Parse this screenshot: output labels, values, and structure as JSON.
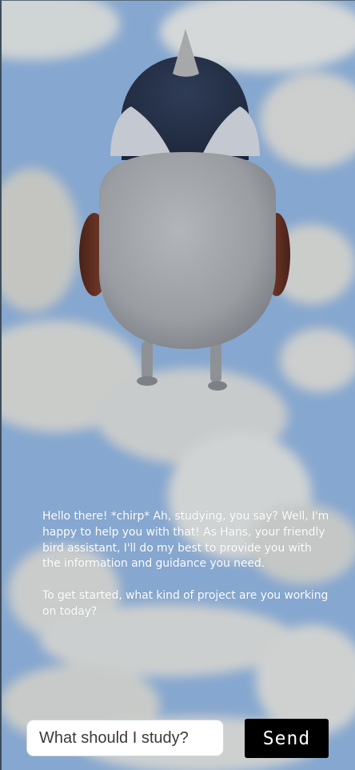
{
  "chat": {
    "assistant_message": "Hello there! *chirp* Ah, studying, you say? Well, I'm happy to help you with that! As Hans, your friendly bird assistant, I'll do my best to provide you with the information and guidance you need.\n\nTo get started, what kind of project are you working on today?"
  },
  "composer": {
    "input_value": "",
    "input_placeholder": "What should I study?",
    "send_label": "Send"
  },
  "colors": {
    "sky": "#86a7cf",
    "cloud": "#e6e4de",
    "bird_body": "#9b9ea3",
    "bird_head": "#27344d",
    "bird_beak": "#a5a5a7",
    "bird_wing": "#6b3527",
    "send_button_bg": "#000000"
  },
  "icons": {
    "character": "bird-avatar"
  }
}
